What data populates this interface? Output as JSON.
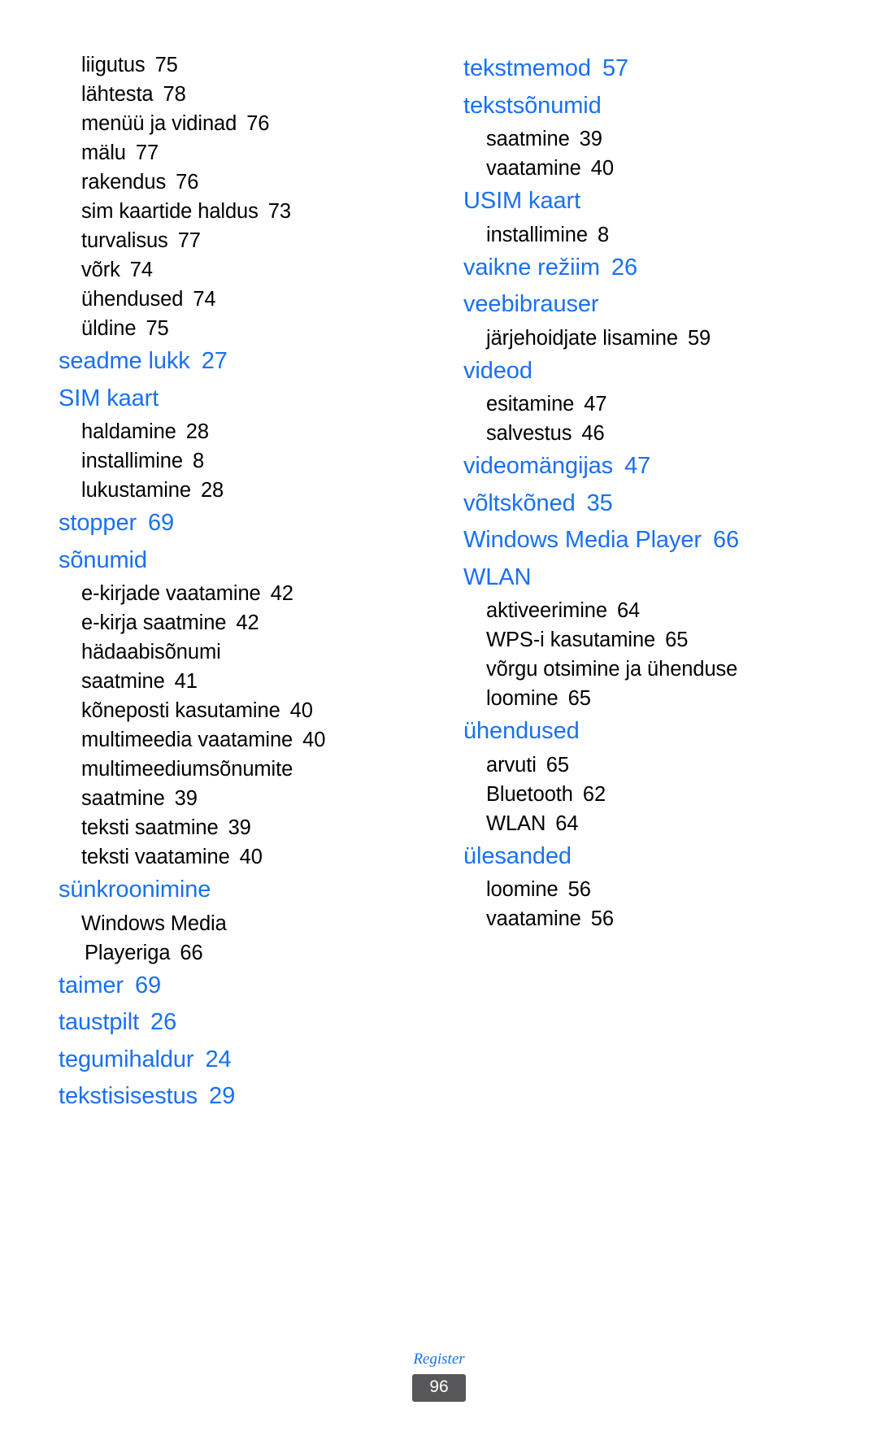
{
  "document": {
    "type": "index",
    "footer_label": "Register",
    "page_number": "96",
    "heading_color": "#1a70f0",
    "subentry_color": "#000000",
    "badge_color": "#58585a"
  },
  "left_column": {
    "entries": [
      {
        "kind": "sub",
        "label": "liigutus",
        "page": "75"
      },
      {
        "kind": "sub",
        "label": "lähtesta",
        "page": "78"
      },
      {
        "kind": "sub",
        "label": "menüü ja vidinad",
        "page": "76"
      },
      {
        "kind": "sub",
        "label": "mälu",
        "page": "77"
      },
      {
        "kind": "sub",
        "label": "rakendus",
        "page": "76"
      },
      {
        "kind": "sub",
        "label": "sim kaartide haldus",
        "page": "73"
      },
      {
        "kind": "sub",
        "label": "turvalisus",
        "page": "77"
      },
      {
        "kind": "sub",
        "label": "võrk",
        "page": "74"
      },
      {
        "kind": "sub",
        "label": "ühendused",
        "page": "74"
      },
      {
        "kind": "sub",
        "label": "üldine",
        "page": "75"
      },
      {
        "kind": "heading",
        "label": "seadme lukk",
        "page": "27"
      },
      {
        "kind": "heading",
        "label": "SIM kaart",
        "page": ""
      },
      {
        "kind": "sub",
        "label": "haldamine",
        "page": "28"
      },
      {
        "kind": "sub",
        "label": "installimine",
        "page": "8"
      },
      {
        "kind": "sub",
        "label": "lukustamine",
        "page": "28"
      },
      {
        "kind": "heading",
        "label": "stopper",
        "page": "69"
      },
      {
        "kind": "heading",
        "label": "sõnumid",
        "page": ""
      },
      {
        "kind": "sub",
        "label": "e-kirjade vaatamine",
        "page": "42"
      },
      {
        "kind": "sub",
        "label": "e-kirja saatmine",
        "page": "42"
      },
      {
        "kind": "sub",
        "label": "hädaabisõnumi",
        "page": ""
      },
      {
        "kind": "cont",
        "label": "saatmine",
        "page": "41"
      },
      {
        "kind": "sub",
        "label": "kõneposti kasutamine",
        "page": "40"
      },
      {
        "kind": "sub",
        "label": "multimeedia vaatamine",
        "page": "40"
      },
      {
        "kind": "sub",
        "label": "multimeediumsõnumite",
        "page": ""
      },
      {
        "kind": "cont",
        "label": "saatmine",
        "page": "39"
      },
      {
        "kind": "sub",
        "label": "teksti saatmine",
        "page": "39"
      },
      {
        "kind": "sub",
        "label": "teksti vaatamine",
        "page": "40"
      },
      {
        "kind": "heading",
        "label": "sünkroonimine",
        "page": ""
      },
      {
        "kind": "sub",
        "label": "Windows Media",
        "page": ""
      },
      {
        "kind": "cont-indent",
        "label": "Playeriga",
        "page": "66"
      },
      {
        "kind": "heading",
        "label": "taimer",
        "page": "69"
      },
      {
        "kind": "heading",
        "label": "taustpilt",
        "page": "26"
      },
      {
        "kind": "heading",
        "label": "tegumihaldur",
        "page": "24"
      },
      {
        "kind": "heading",
        "label": "tekstisisestus",
        "page": "29"
      }
    ]
  },
  "right_column": {
    "entries": [
      {
        "kind": "heading",
        "label": "tekstmemod",
        "page": "57"
      },
      {
        "kind": "heading",
        "label": "tekstsõnumid",
        "page": ""
      },
      {
        "kind": "sub",
        "label": "saatmine",
        "page": "39"
      },
      {
        "kind": "sub",
        "label": "vaatamine",
        "page": "40"
      },
      {
        "kind": "heading",
        "label": "USIM kaart",
        "page": ""
      },
      {
        "kind": "sub",
        "label": "installimine",
        "page": "8"
      },
      {
        "kind": "heading",
        "label": "vaikne režiim",
        "page": "26"
      },
      {
        "kind": "heading",
        "label": "veebibrauser",
        "page": ""
      },
      {
        "kind": "sub",
        "label": "järjehoidjate lisamine",
        "page": "59"
      },
      {
        "kind": "heading",
        "label": "videod",
        "page": ""
      },
      {
        "kind": "sub",
        "label": "esitamine",
        "page": "47"
      },
      {
        "kind": "sub",
        "label": "salvestus",
        "page": "46"
      },
      {
        "kind": "heading",
        "label": "videomängijas",
        "page": "47"
      },
      {
        "kind": "heading",
        "label": "võltskõned",
        "page": "35"
      },
      {
        "kind": "heading",
        "label": "Windows Media Player",
        "page": "66"
      },
      {
        "kind": "heading",
        "label": "WLAN",
        "page": ""
      },
      {
        "kind": "sub",
        "label": "aktiveerimine",
        "page": "64"
      },
      {
        "kind": "sub",
        "label": "WPS-i kasutamine",
        "page": "65"
      },
      {
        "kind": "sub",
        "label": "võrgu otsimine ja ühenduse",
        "page": ""
      },
      {
        "kind": "cont",
        "label": "loomine",
        "page": "65"
      },
      {
        "kind": "heading",
        "label": "ühendused",
        "page": ""
      },
      {
        "kind": "sub",
        "label": "arvuti",
        "page": "65"
      },
      {
        "kind": "sub",
        "label": "Bluetooth",
        "page": "62"
      },
      {
        "kind": "sub",
        "label": "WLAN",
        "page": "64"
      },
      {
        "kind": "heading",
        "label": "ülesanded",
        "page": ""
      },
      {
        "kind": "sub",
        "label": "loomine",
        "page": "56"
      },
      {
        "kind": "sub",
        "label": "vaatamine",
        "page": "56"
      }
    ]
  }
}
